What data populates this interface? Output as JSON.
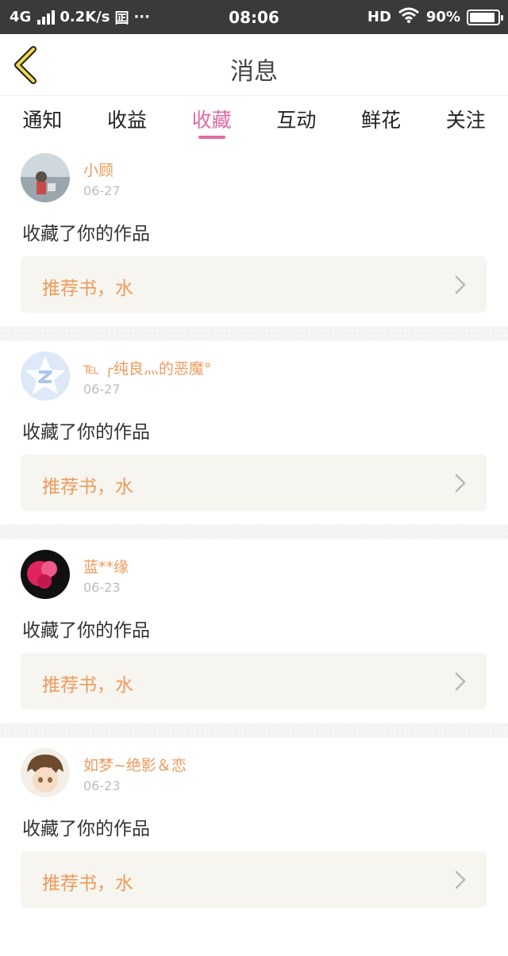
{
  "status_bar": {
    "network": "4G",
    "speed": "0.2K/s",
    "extra_icon": "囸",
    "dots": "···",
    "time": "08:06",
    "hd": "HD",
    "battery": "90%",
    "battery_level": 0.9
  },
  "header": {
    "title": "消息",
    "back_icon": "chevron-left-icon"
  },
  "tabs": [
    {
      "label": "通知",
      "active": false
    },
    {
      "label": "收益",
      "active": false
    },
    {
      "label": "收藏",
      "active": true
    },
    {
      "label": "互动",
      "active": false
    },
    {
      "label": "鲜花",
      "active": false
    },
    {
      "label": "关注",
      "active": false
    }
  ],
  "messages": [
    {
      "user": "小顾",
      "date": "06-27",
      "action": "收藏了你的作品",
      "work": "推荐书，水"
    },
    {
      "user": "℡ ╭纯良灬的恶魔°",
      "date": "06-27",
      "action": "收藏了你的作品",
      "work": "推荐书，水"
    },
    {
      "user": "蓝**缘",
      "date": "06-23",
      "action": "收藏了你的作品",
      "work": "推荐书，水"
    },
    {
      "user": "如梦~绝影＆恋",
      "date": "06-23",
      "action": "收藏了你的作品",
      "work": "推荐书，水"
    }
  ],
  "colors": {
    "accent": "#e06aa3",
    "name": "#ef9a5b",
    "work_bg": "#f7f5f0",
    "status_bar": "#3a3a3a"
  }
}
